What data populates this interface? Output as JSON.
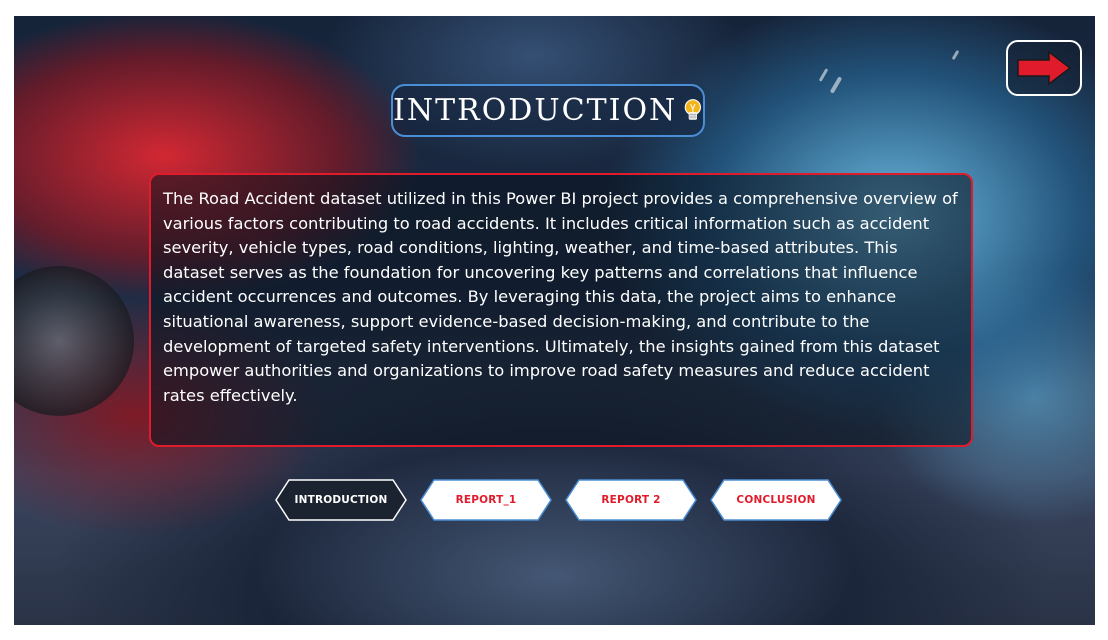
{
  "title": "INTRODUCTION",
  "intro_text": "The Road Accident dataset utilized in this Power BI project provides a comprehensive overview of various factors contributing to road accidents. It includes critical information such as accident severity, vehicle types, road conditions, lighting, weather, and time-based attributes. This dataset serves as the foundation for uncovering key patterns and correlations that influence accident occurrences and outcomes. By leveraging this data, the project aims to enhance situational awareness, support evidence-based decision-making, and contribute to the development of targeted safety interventions. Ultimately, the insights gained from this dataset empower authorities and organizations to improve road safety measures and reduce accident rates effectively.",
  "nav": {
    "items": [
      {
        "label": "INTRODUCTION",
        "active": true
      },
      {
        "label": "REPORT_1",
        "active": false
      },
      {
        "label": "REPORT 2",
        "active": false
      },
      {
        "label": "CONCLUSION",
        "active": false
      }
    ]
  },
  "icons": {
    "title_icon": "lightbulb-icon",
    "next_icon": "arrow-right-icon"
  },
  "colors": {
    "accent_red": "#e01b2b",
    "accent_blue": "#4a8fd6",
    "nav_active_bg": "#1b2230",
    "nav_inactive_bg": "#ffffff",
    "nav_inactive_text": "#e01b2b"
  }
}
